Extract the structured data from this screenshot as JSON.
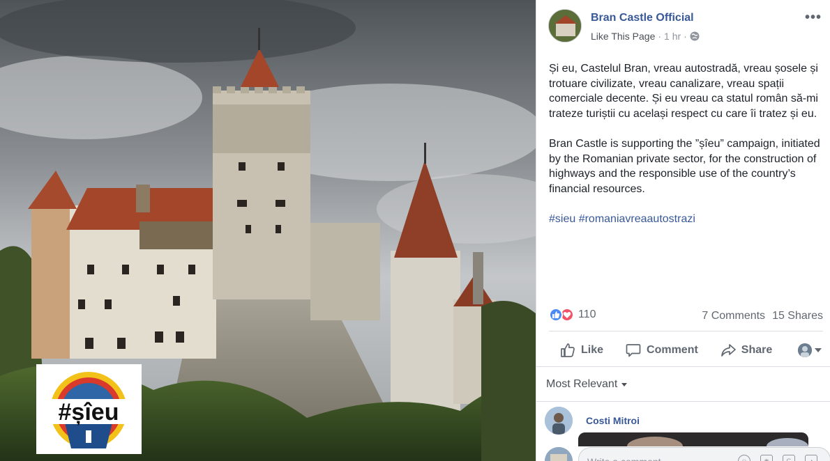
{
  "post": {
    "page_name": "Bran Castle Official",
    "like_page": "Like This Page",
    "separator": "·",
    "time": "1 hr",
    "more": "•••",
    "paragraph_ro": "Și eu, Castelul Bran, vreau autostradă, vreau șosele și trotuare civilizate, vreau canalizare, vreau spații comerciale decente. Și eu vreau ca statul român să-mi trateze turiștii cu același respect cu care îi tratez și eu.",
    "paragraph_en": "Bran Castle is supporting the ”șîeu” campaign, initiated by the Romanian private sector, for the construction of highways and the responsible use of the country’s financial resources.",
    "hashtags": "#sieu #romaniavreaautostrazi"
  },
  "image": {
    "logo_text": "#șîeu"
  },
  "stats": {
    "reaction_count": "110",
    "comments": "7 Comments",
    "shares": "15 Shares"
  },
  "actions": {
    "like": "Like",
    "comment": "Comment",
    "share": "Share"
  },
  "comments": {
    "sort_label": "Most Relevant",
    "first_commenter": "Costi Mitroi",
    "write_placeholder": "Write a comment..."
  },
  "colors": {
    "link_blue": "#385898",
    "like_blue": "#4a8bf5",
    "love_red": "#f25268"
  }
}
